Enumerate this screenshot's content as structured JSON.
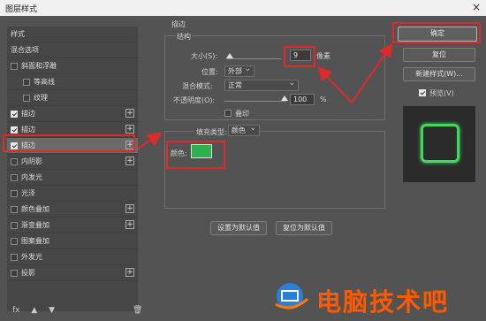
{
  "window": {
    "title": "图层样式",
    "close": "×"
  },
  "styles_list": {
    "header": "样式",
    "blend_options": "混合选项",
    "items": [
      {
        "label": "斜面和浮雕",
        "checked": false,
        "plus": false,
        "indent": false
      },
      {
        "label": "等高线",
        "checked": false,
        "plus": false,
        "indent": true
      },
      {
        "label": "纹理",
        "checked": false,
        "plus": false,
        "indent": true
      },
      {
        "label": "描边",
        "checked": true,
        "plus": true,
        "indent": false
      },
      {
        "label": "描边",
        "checked": true,
        "plus": true,
        "indent": false
      },
      {
        "label": "描边",
        "checked": true,
        "plus": true,
        "indent": false,
        "selected": true
      },
      {
        "label": "内阴影",
        "checked": false,
        "plus": true,
        "indent": false
      },
      {
        "label": "内发光",
        "checked": false,
        "plus": false,
        "indent": false
      },
      {
        "label": "光泽",
        "checked": false,
        "plus": false,
        "indent": false
      },
      {
        "label": "颜色叠加",
        "checked": false,
        "plus": true,
        "indent": false
      },
      {
        "label": "渐变叠加",
        "checked": false,
        "plus": true,
        "indent": false
      },
      {
        "label": "图案叠加",
        "checked": false,
        "plus": false,
        "indent": false
      },
      {
        "label": "外发光",
        "checked": false,
        "plus": false,
        "indent": false
      },
      {
        "label": "投影",
        "checked": false,
        "plus": true,
        "indent": false
      }
    ],
    "bottom_icons": [
      "fx",
      "▲",
      "▼"
    ],
    "trash": "🗑"
  },
  "stroke": {
    "section_title": "描边",
    "structure_title": "结构",
    "size_label": "大小(S):",
    "size_value": "9",
    "size_unit": "像素",
    "position_label": "位置:",
    "position_value": "外部",
    "blend_label": "混合模式:",
    "blend_value": "正常",
    "opacity_label": "不透明度(O):",
    "opacity_value": "100",
    "opacity_unit": "%",
    "overprint_label": "叠印",
    "fill_type_label": "填充类型:",
    "fill_type_value": "颜色",
    "color_label": "颜色:",
    "color_hex": "#2bb24c",
    "set_default": "设置为默认值",
    "reset_default": "复位为默认值"
  },
  "buttons": {
    "ok": "确定",
    "reset": "复位",
    "new_style": "新建样式(W)...",
    "preview_label": "预览(V)",
    "preview_checked": true
  },
  "watermark": {
    "text": "电脑技术吧"
  }
}
